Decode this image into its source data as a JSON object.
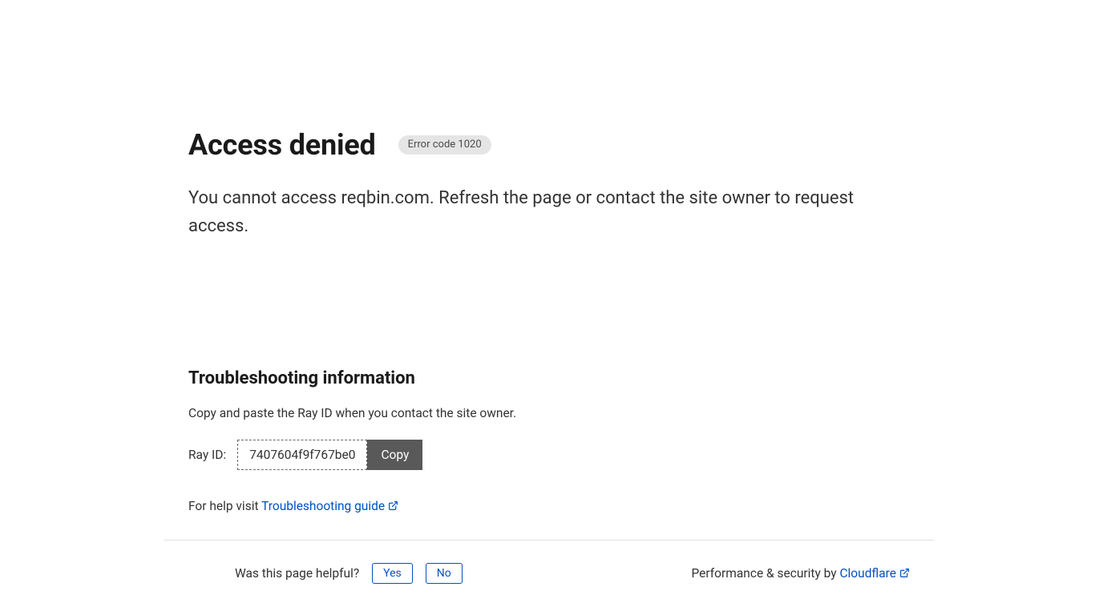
{
  "header": {
    "title": "Access denied",
    "error_code": "Error code 1020"
  },
  "message": "You cannot access reqbin.com. Refresh the page or contact the site owner to request access.",
  "troubleshoot": {
    "heading": "Troubleshooting information",
    "instruction": "Copy and paste the Ray ID when you contact the site owner.",
    "ray_label": "Ray ID:",
    "ray_value": "7407604f9f767be0",
    "copy_label": "Copy",
    "help_prefix": "For help visit ",
    "help_link": "Troubleshooting guide"
  },
  "footer": {
    "prompt": "Was this page helpful?",
    "yes": "Yes",
    "no": "No",
    "perf_prefix": "Performance & security by ",
    "perf_link": "Cloudflare"
  }
}
